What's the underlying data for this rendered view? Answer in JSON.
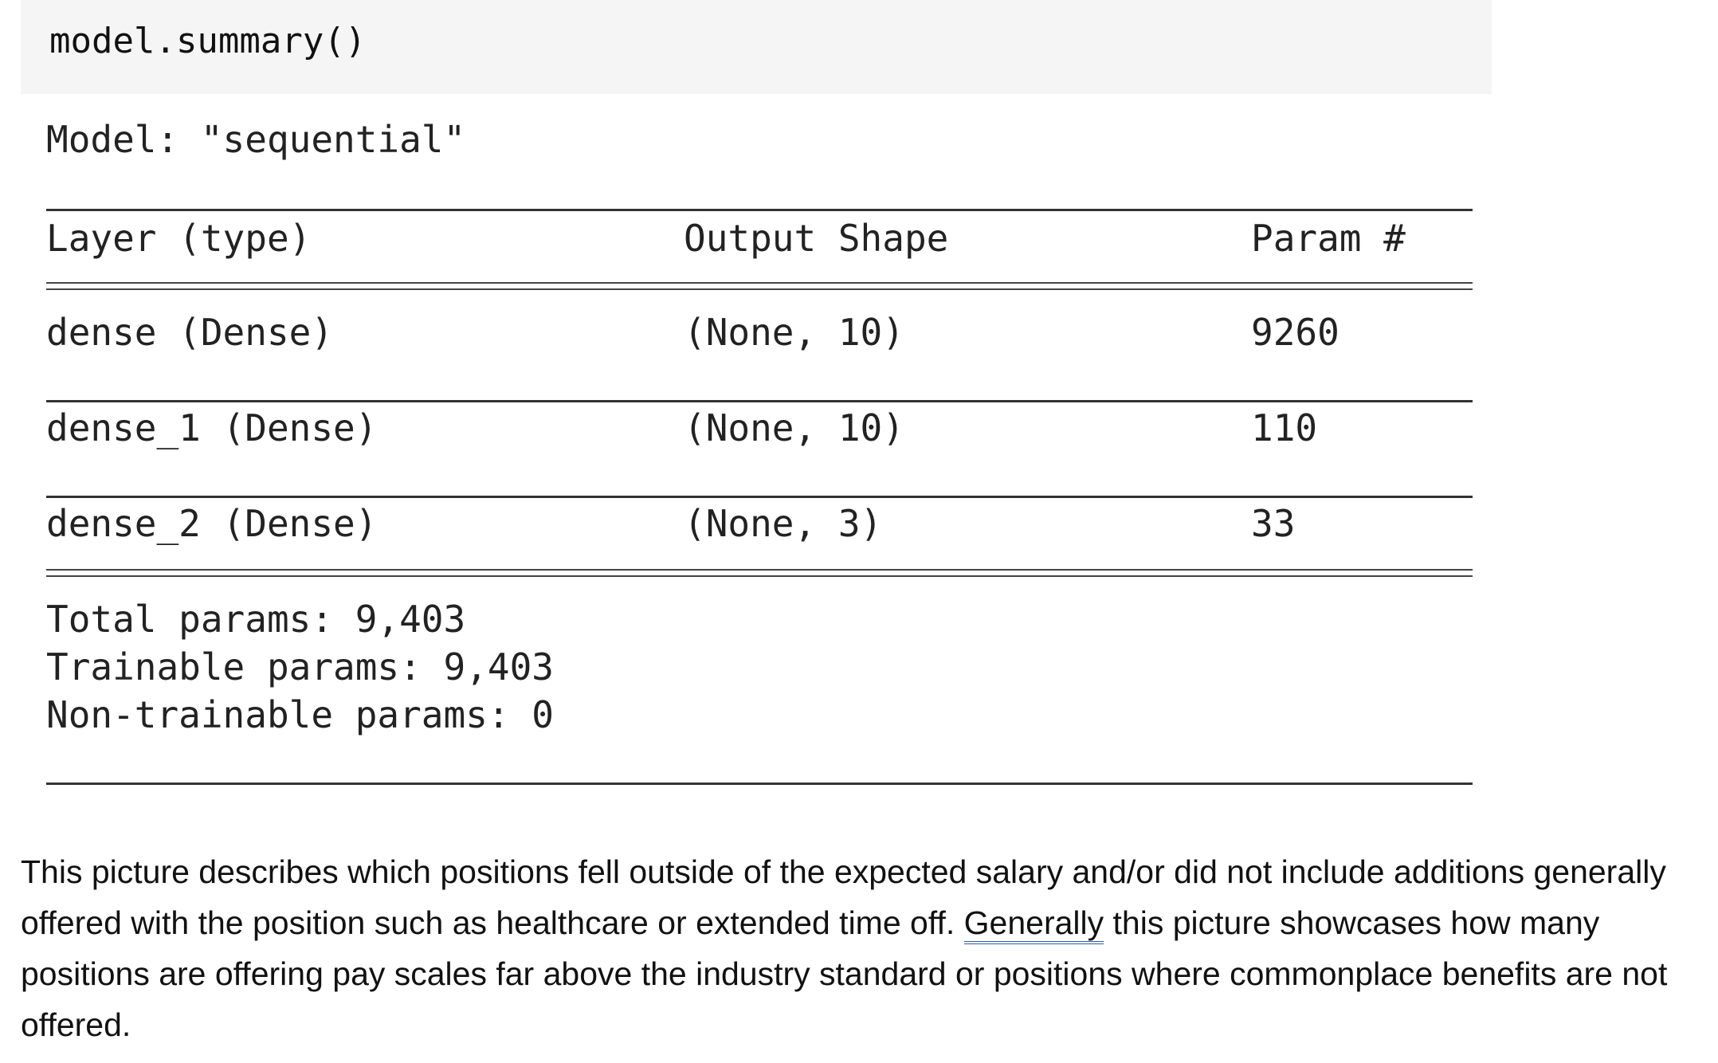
{
  "code_cell": {
    "code": "model.summary()"
  },
  "model_output": {
    "model_line": "Model: \"sequential\"",
    "headers": {
      "layer": "Layer (type)",
      "output_shape": "Output Shape",
      "params": "Param #"
    },
    "layers": [
      {
        "layer": "dense (Dense)",
        "output_shape": "(None, 10)",
        "params": "9260"
      },
      {
        "layer": "dense_1 (Dense)",
        "output_shape": "(None, 10)",
        "params": "110"
      },
      {
        "layer": "dense_2 (Dense)",
        "output_shape": "(None, 3)",
        "params": "33"
      }
    ],
    "total_params": "Total params: 9,403",
    "trainable_params": "Trainable params: 9,403",
    "non_trainable_params": "Non-trainable params: 0"
  },
  "description": {
    "part1": "This picture describes which positions fell outside of the expected salary and/or did not include additions generally offered with the position such as healthcare or extended time off.  ",
    "flagged_word": "Generally",
    "part2": " this picture showcases how many positions are offering pay scales far above the industry standard or positions where commonplace benefits are not offered."
  }
}
